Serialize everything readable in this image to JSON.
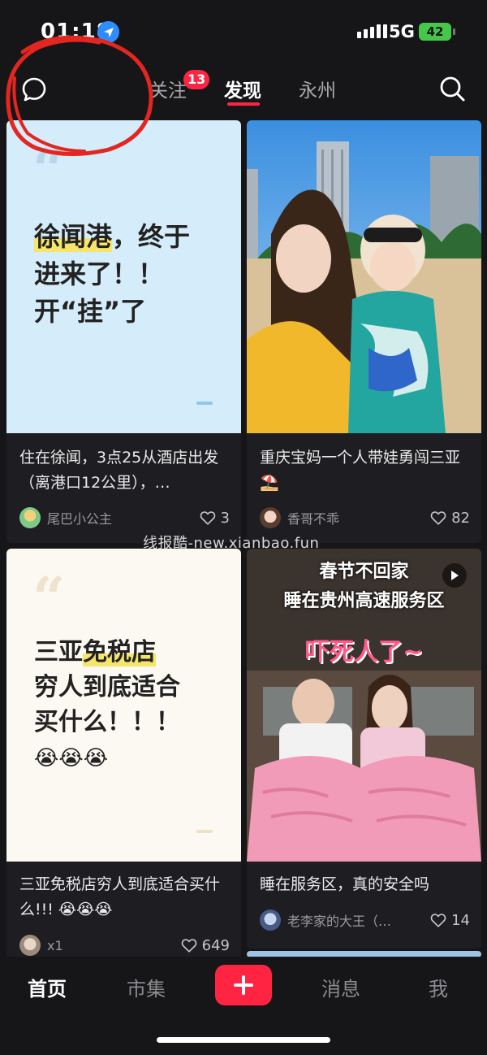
{
  "status_bar": {
    "time": "01:18",
    "network": "5G",
    "battery": "42"
  },
  "top_nav": {
    "tabs": [
      {
        "label": "关注",
        "badge": "13"
      },
      {
        "label": "发现",
        "active": true
      },
      {
        "label": "永州"
      }
    ]
  },
  "feed": [
    {
      "cover_lines": [
        "徐闻港",
        "，终于",
        "进来了！！",
        "开“挂”了"
      ],
      "title": "住在徐闻，3点25从酒店出发（离港口12公里），…",
      "author": "尾巴小公主",
      "likes": "3"
    },
    {
      "title": "重庆宝妈一个人带娃勇闯三亚⛱️",
      "author": "香哥不乖",
      "likes": "82"
    },
    {
      "cover_lines": [
        "三亚",
        "免税店",
        "穷人到底适合",
        "买什么！！！"
      ],
      "cover_emoji": "😭😭😭",
      "title": "三亚免税店穷人到底适合买什么!!! 😭😭😭",
      "author": "x1",
      "likes": "649"
    },
    {
      "cover_title_1": "春节不回家",
      "cover_title_2": "睡在贵州高速服务区",
      "cover_title_3": "吓死人了~",
      "title": "睡在服务区，真的安全吗",
      "author": "老李家的大王（…",
      "likes": "14"
    }
  ],
  "watermark": "线报酷-new.xianbao.fun",
  "bottom_tabs": {
    "home": "首页",
    "market": "市集",
    "messages": "消息",
    "me": "我"
  },
  "colors": {
    "accent": "#ff2442",
    "background": "#161619",
    "card": "#1e1e22"
  }
}
